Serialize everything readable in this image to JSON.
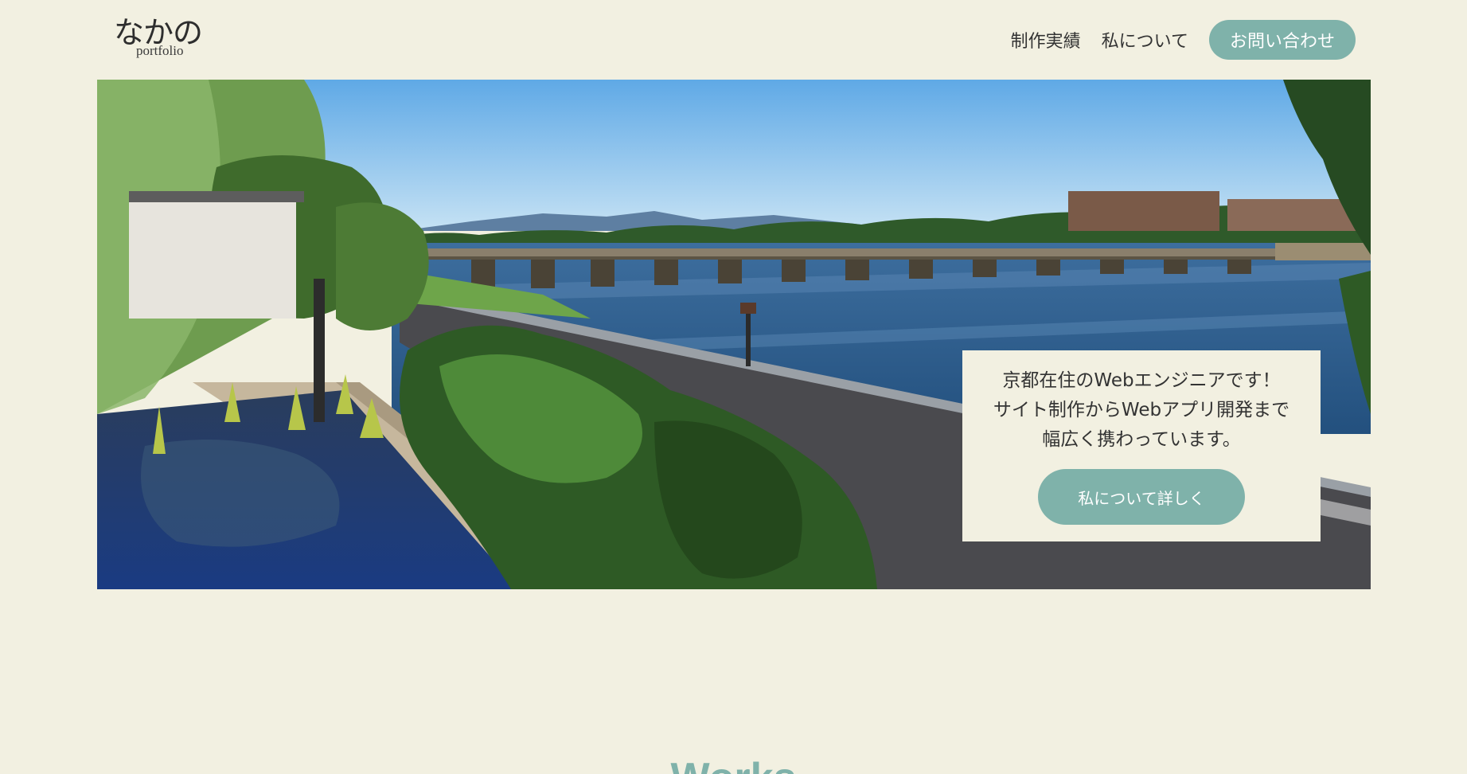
{
  "header": {
    "logo_text": "なかの",
    "logo_subtext": "portfolio",
    "nav": [
      {
        "label": "制作実績"
      },
      {
        "label": "私について"
      }
    ],
    "contact_label": "お問い合わせ"
  },
  "hero": {
    "image_alt": "Kyoto river landscape with bridge",
    "lines": [
      "京都在住のWebエンジニアです！",
      "サイト制作からWebアプリ開発まで",
      "幅広く携わっています。"
    ],
    "button_label": "私について詳しく"
  },
  "sections": {
    "works_title": "Works"
  },
  "colors": {
    "background": "#f2f0e1",
    "accent": "#7fb2aa",
    "text": "#333333"
  }
}
